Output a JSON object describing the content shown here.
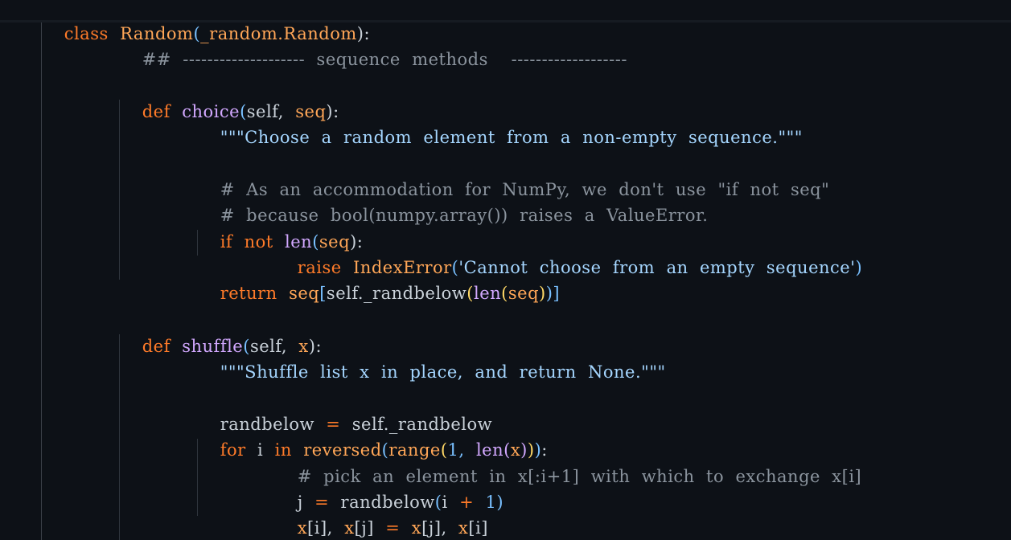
{
  "code": {
    "l1": {
      "kw": "class",
      "name": "Random",
      "open": "(",
      "base": "_random.Random",
      "close": "):"
    },
    "l2": {
      "hashes": "##",
      "dashes_left": "--------------------",
      "text": "sequence  methods",
      "dashes_right": "-------------------"
    },
    "l3": {
      "kw": "def",
      "name": "choice",
      "open": "(",
      "self": "self,",
      "param": "seq",
      "close": "):"
    },
    "l4": {
      "doc": "\"\"\"Choose  a  random  element  from  a  non-empty  sequence.\"\"\""
    },
    "l5": {
      "comment": "#  As  an  accommodation  for  NumPy,  we  don't  use  \"if  not  seq\""
    },
    "l6": {
      "comment": "#  because  bool(numpy.array())  raises  a  ValueError."
    },
    "l7": {
      "kw1": "if",
      "kw2": "not",
      "fn": "len",
      "open": "(",
      "arg": "seq",
      "close": "):"
    },
    "l8": {
      "kw": "raise",
      "exc": "IndexError",
      "open": "(",
      "msg": "'Cannot  choose  from  an  empty  sequence'",
      "close": ")"
    },
    "l9": {
      "kw": "return",
      "seq": "seq",
      "ob": "[",
      "call": "self._randbelow",
      "p1": "(",
      "fn": "len",
      "p2": "(",
      "arg": "seq",
      "p3": ")",
      "p4": ")",
      "cb": "]"
    },
    "l10": {
      "kw": "def",
      "name": "shuffle",
      "open": "(",
      "self": "self,",
      "param": "x",
      "close": "):"
    },
    "l11": {
      "doc": "\"\"\"Shuffle  list  x  in  place,  and  return  None.\"\"\""
    },
    "l12": {
      "lhs": "randbelow",
      "eq": "=",
      "rhs": "self._randbelow"
    },
    "l13": {
      "kw": "for",
      "var": "i",
      "kw2": "in",
      "fn": "reversed",
      "p1": "(",
      "fn2": "range",
      "p2": "(",
      "n1": "1,",
      "fn3": "len",
      "p3": "(",
      "arg": "x",
      "p4": ")",
      "p5": ")",
      "p6": ")",
      "colon": ":"
    },
    "l14": {
      "comment": "#  pick  an  element  in  x[:i+1]  with  which  to  exchange  x[i]"
    },
    "l15": {
      "lhs": "j",
      "eq": "=",
      "fn": "randbelow",
      "open": "(",
      "var": "i",
      "plus": "+",
      "num": "1",
      "close": ")"
    },
    "l16": {
      "a": "x",
      "a_idx": "[i],",
      "b": "x",
      "b_idx": "[j]",
      "eq": "=",
      "c": "x",
      "c_idx": "[j],",
      "d": "x",
      "d_idx": "[i]"
    }
  },
  "colors": {
    "background": "#0d1117",
    "keyword": "#ff7b29",
    "function": "#d2a8ff",
    "string": "#a5d6ff",
    "comment": "#8b949e",
    "identifier": "#c9d1d9"
  }
}
